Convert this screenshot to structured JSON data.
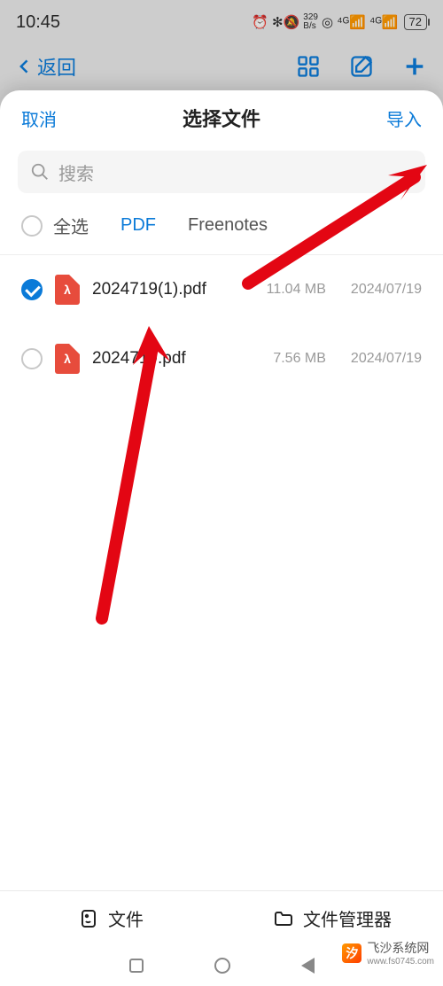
{
  "status": {
    "time": "10:45",
    "battery": "72"
  },
  "nav": {
    "back": "返回"
  },
  "sheet": {
    "cancel": "取消",
    "title": "选择文件",
    "import": "导入",
    "search_placeholder": "搜索",
    "select_all": "全选",
    "tabs": [
      {
        "label": "PDF",
        "active": true
      },
      {
        "label": "Freenotes",
        "active": false
      }
    ],
    "files": [
      {
        "name": "2024719(1).pdf",
        "size": "11.04 MB",
        "date": "2024/07/19",
        "selected": true
      },
      {
        "name": "2024719.pdf",
        "size": "7.56 MB",
        "date": "2024/07/19",
        "selected": false
      }
    ]
  },
  "bottom": {
    "file": "文件",
    "manager": "文件管理器"
  },
  "watermark": {
    "name": "飞沙系统网",
    "url": "www.fs0745.com"
  }
}
